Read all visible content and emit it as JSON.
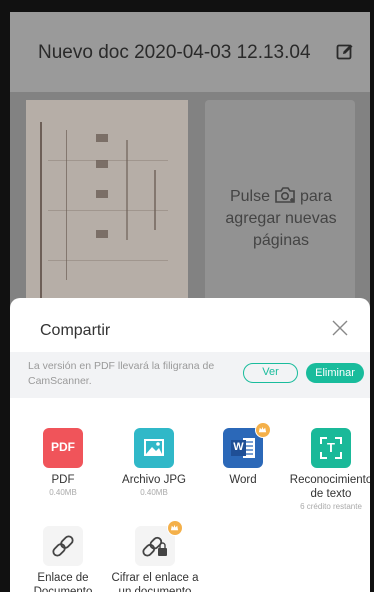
{
  "document": {
    "title": "Nuevo doc 2020-04-03 12.13.04",
    "add_pages_pre": "Pulse",
    "add_pages_post": "para agregar nuevas páginas"
  },
  "share_sheet": {
    "title": "Compartir",
    "notice": "La versión en PDF llevará la filigrana de CamScanner.",
    "view_label": "Ver",
    "remove_label": "Eliminar",
    "options": [
      {
        "label": "PDF",
        "sub": "0.40MB",
        "icon_text": "PDF"
      },
      {
        "label": "Archivo JPG",
        "sub": "0.40MB"
      },
      {
        "label": "Word",
        "icon_text": "W"
      },
      {
        "label": "Reconocimiento de texto",
        "sub": "6 crédito restante",
        "icon_text": "T"
      },
      {
        "label": "Enlace de Documento"
      },
      {
        "label": "Cifrar el enlace a un documento"
      }
    ]
  },
  "colors": {
    "accent": "#19bc9c",
    "pdf": "#f0545a",
    "jpg": "#30b8c8",
    "word": "#2b68b8",
    "ocr": "#1ab999",
    "premium": "#f4b04a"
  }
}
